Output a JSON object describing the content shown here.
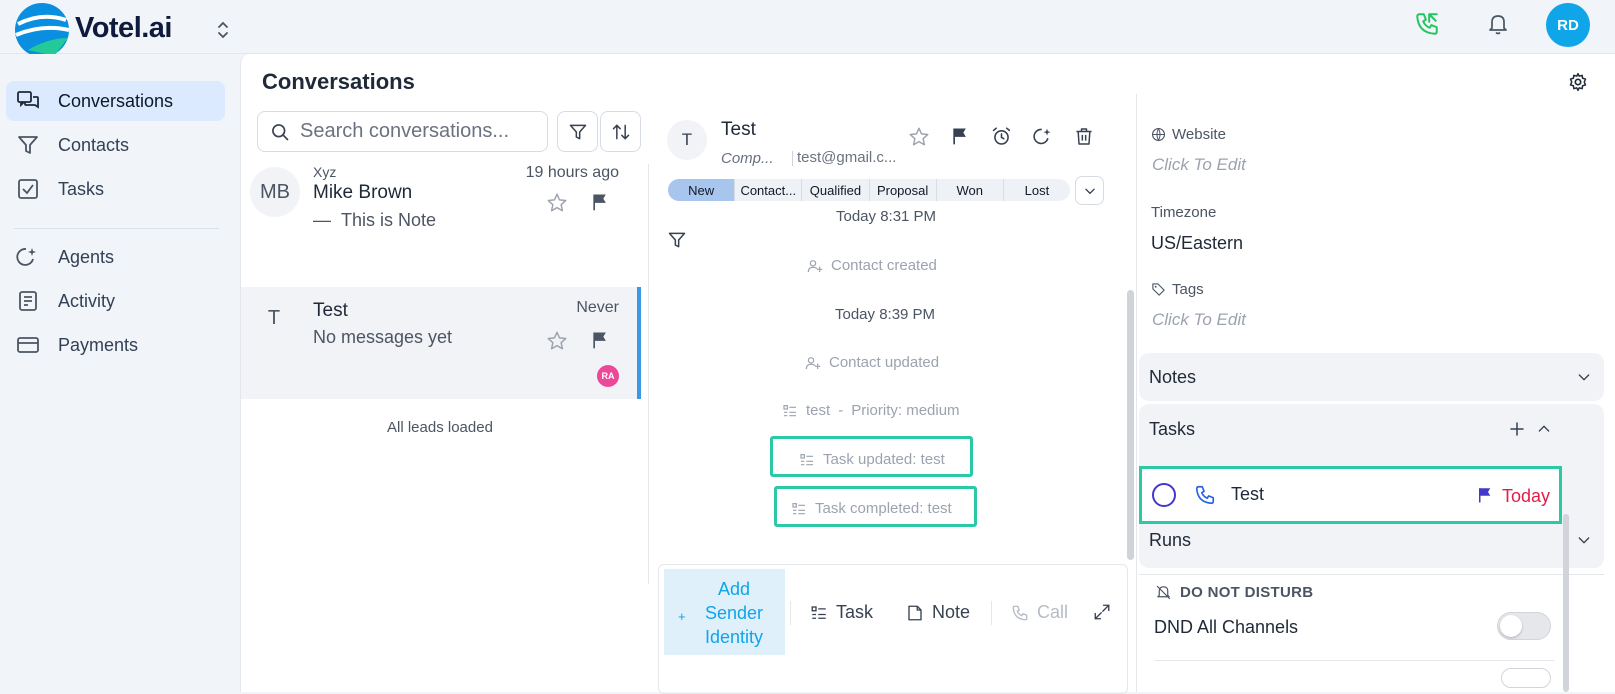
{
  "app": {
    "name": "Votel.ai",
    "user_initials": "RD"
  },
  "sidebar": {
    "items": [
      {
        "label": "Conversations",
        "icon": "chat-icon",
        "active": true
      },
      {
        "label": "Contacts",
        "icon": "filter-icon"
      },
      {
        "label": "Tasks",
        "icon": "checkbox-icon"
      },
      {
        "label": "Agents",
        "icon": "agent-icon"
      },
      {
        "label": "Activity",
        "icon": "activity-icon"
      },
      {
        "label": "Payments",
        "icon": "card-icon"
      }
    ]
  },
  "page": {
    "title": "Conversations"
  },
  "search": {
    "placeholder": "Search conversations..."
  },
  "conversations": [
    {
      "initials": "MB",
      "company": "Xyz",
      "name": "Mike Brown",
      "preview": "This is Note",
      "time": "19 hours ago"
    },
    {
      "initials": "T",
      "company": "",
      "name": "Test",
      "preview": "No messages yet",
      "time": "Never",
      "assignee": "RA",
      "selected": true
    }
  ],
  "list_footer": "All leads loaded",
  "detail": {
    "initials": "T",
    "name": "Test",
    "company": "Comp...",
    "email": "test@gmail.c...",
    "pipeline": [
      "New",
      "Contact...",
      "Qualified",
      "Proposal",
      "Won",
      "Lost"
    ],
    "active_stage": "New"
  },
  "timeline": [
    {
      "type": "time",
      "text": "Today 8:31 PM"
    },
    {
      "type": "event",
      "icon": "user-plus-icon",
      "text": "Contact created"
    },
    {
      "type": "time",
      "text": "Today 8:39 PM"
    },
    {
      "type": "event",
      "icon": "user-plus-icon",
      "text": "Contact updated"
    },
    {
      "type": "event",
      "icon": "task-list-icon",
      "text": "test",
      "priority": "Priority: medium"
    },
    {
      "type": "event",
      "icon": "task-list-icon",
      "text": "Task updated: test",
      "highlighted": true
    },
    {
      "type": "event",
      "icon": "task-list-icon",
      "text": "Task completed: test",
      "highlighted": true
    }
  ],
  "composer": {
    "add_sender": "Add Sender Identity",
    "task": "Task",
    "note": "Note",
    "call": "Call"
  },
  "right_panel": {
    "website_label": "Website",
    "website_value": "Click To Edit",
    "timezone_label": "Timezone",
    "timezone_value": "US/Eastern",
    "tags_label": "Tags",
    "tags_value": "Click To Edit",
    "notes_title": "Notes",
    "tasks_title": "Tasks",
    "task_item": {
      "title": "Test",
      "due": "Today"
    },
    "runs_title": "Runs",
    "dnd_label": "DO NOT DISTURB",
    "dnd_name": "DND All Channels",
    "dnd_enabled": false
  },
  "colors": {
    "accent": "#0ea5e9",
    "highlight": "#2cc9a7",
    "due_today": "#e11d48",
    "flag_priority": "#4338ca",
    "phone_active": "#22c55e"
  }
}
